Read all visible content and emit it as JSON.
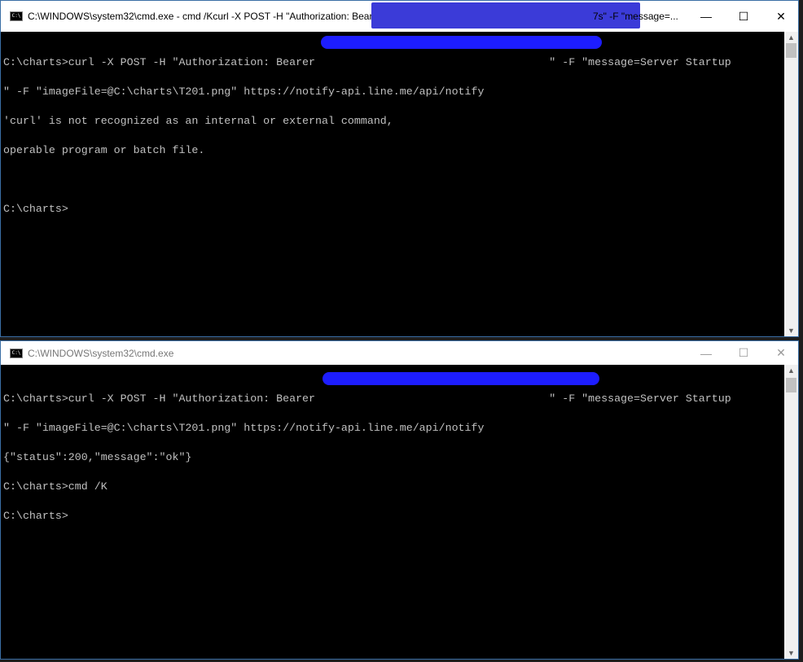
{
  "window1": {
    "title": "C:\\WINDOWS\\system32\\cmd.exe - cmd  /Kcurl -X POST -H \"Authorization: Bearer 33l",
    "title_tail": "7s\" -F \"message=...",
    "lines": [
      "C:\\charts>curl -X POST -H \"Authorization: Bearer                                    \" -F \"message=Server Startup",
      "\" -F \"imageFile=@C:\\charts\\T201.png\" https://notify-api.line.me/api/notify",
      "'curl' is not recognized as an internal or external command,",
      "operable program or batch file.",
      "",
      "C:\\charts>"
    ]
  },
  "window2": {
    "title": "C:\\WINDOWS\\system32\\cmd.exe",
    "lines": [
      "C:\\charts>curl -X POST -H \"Authorization: Bearer                                    \" -F \"message=Server Startup",
      "\" -F \"imageFile=@C:\\charts\\T201.png\" https://notify-api.line.me/api/notify",
      "{\"status\":200,\"message\":\"ok\"}",
      "C:\\charts>cmd /K",
      "C:\\charts>"
    ]
  },
  "controls": {
    "minimize": "—",
    "maximize": "☐",
    "close": "✕"
  },
  "colors": {
    "redaction": "#1d1dff",
    "terminal_bg": "#000000",
    "terminal_fg": "#c0c0c0"
  }
}
